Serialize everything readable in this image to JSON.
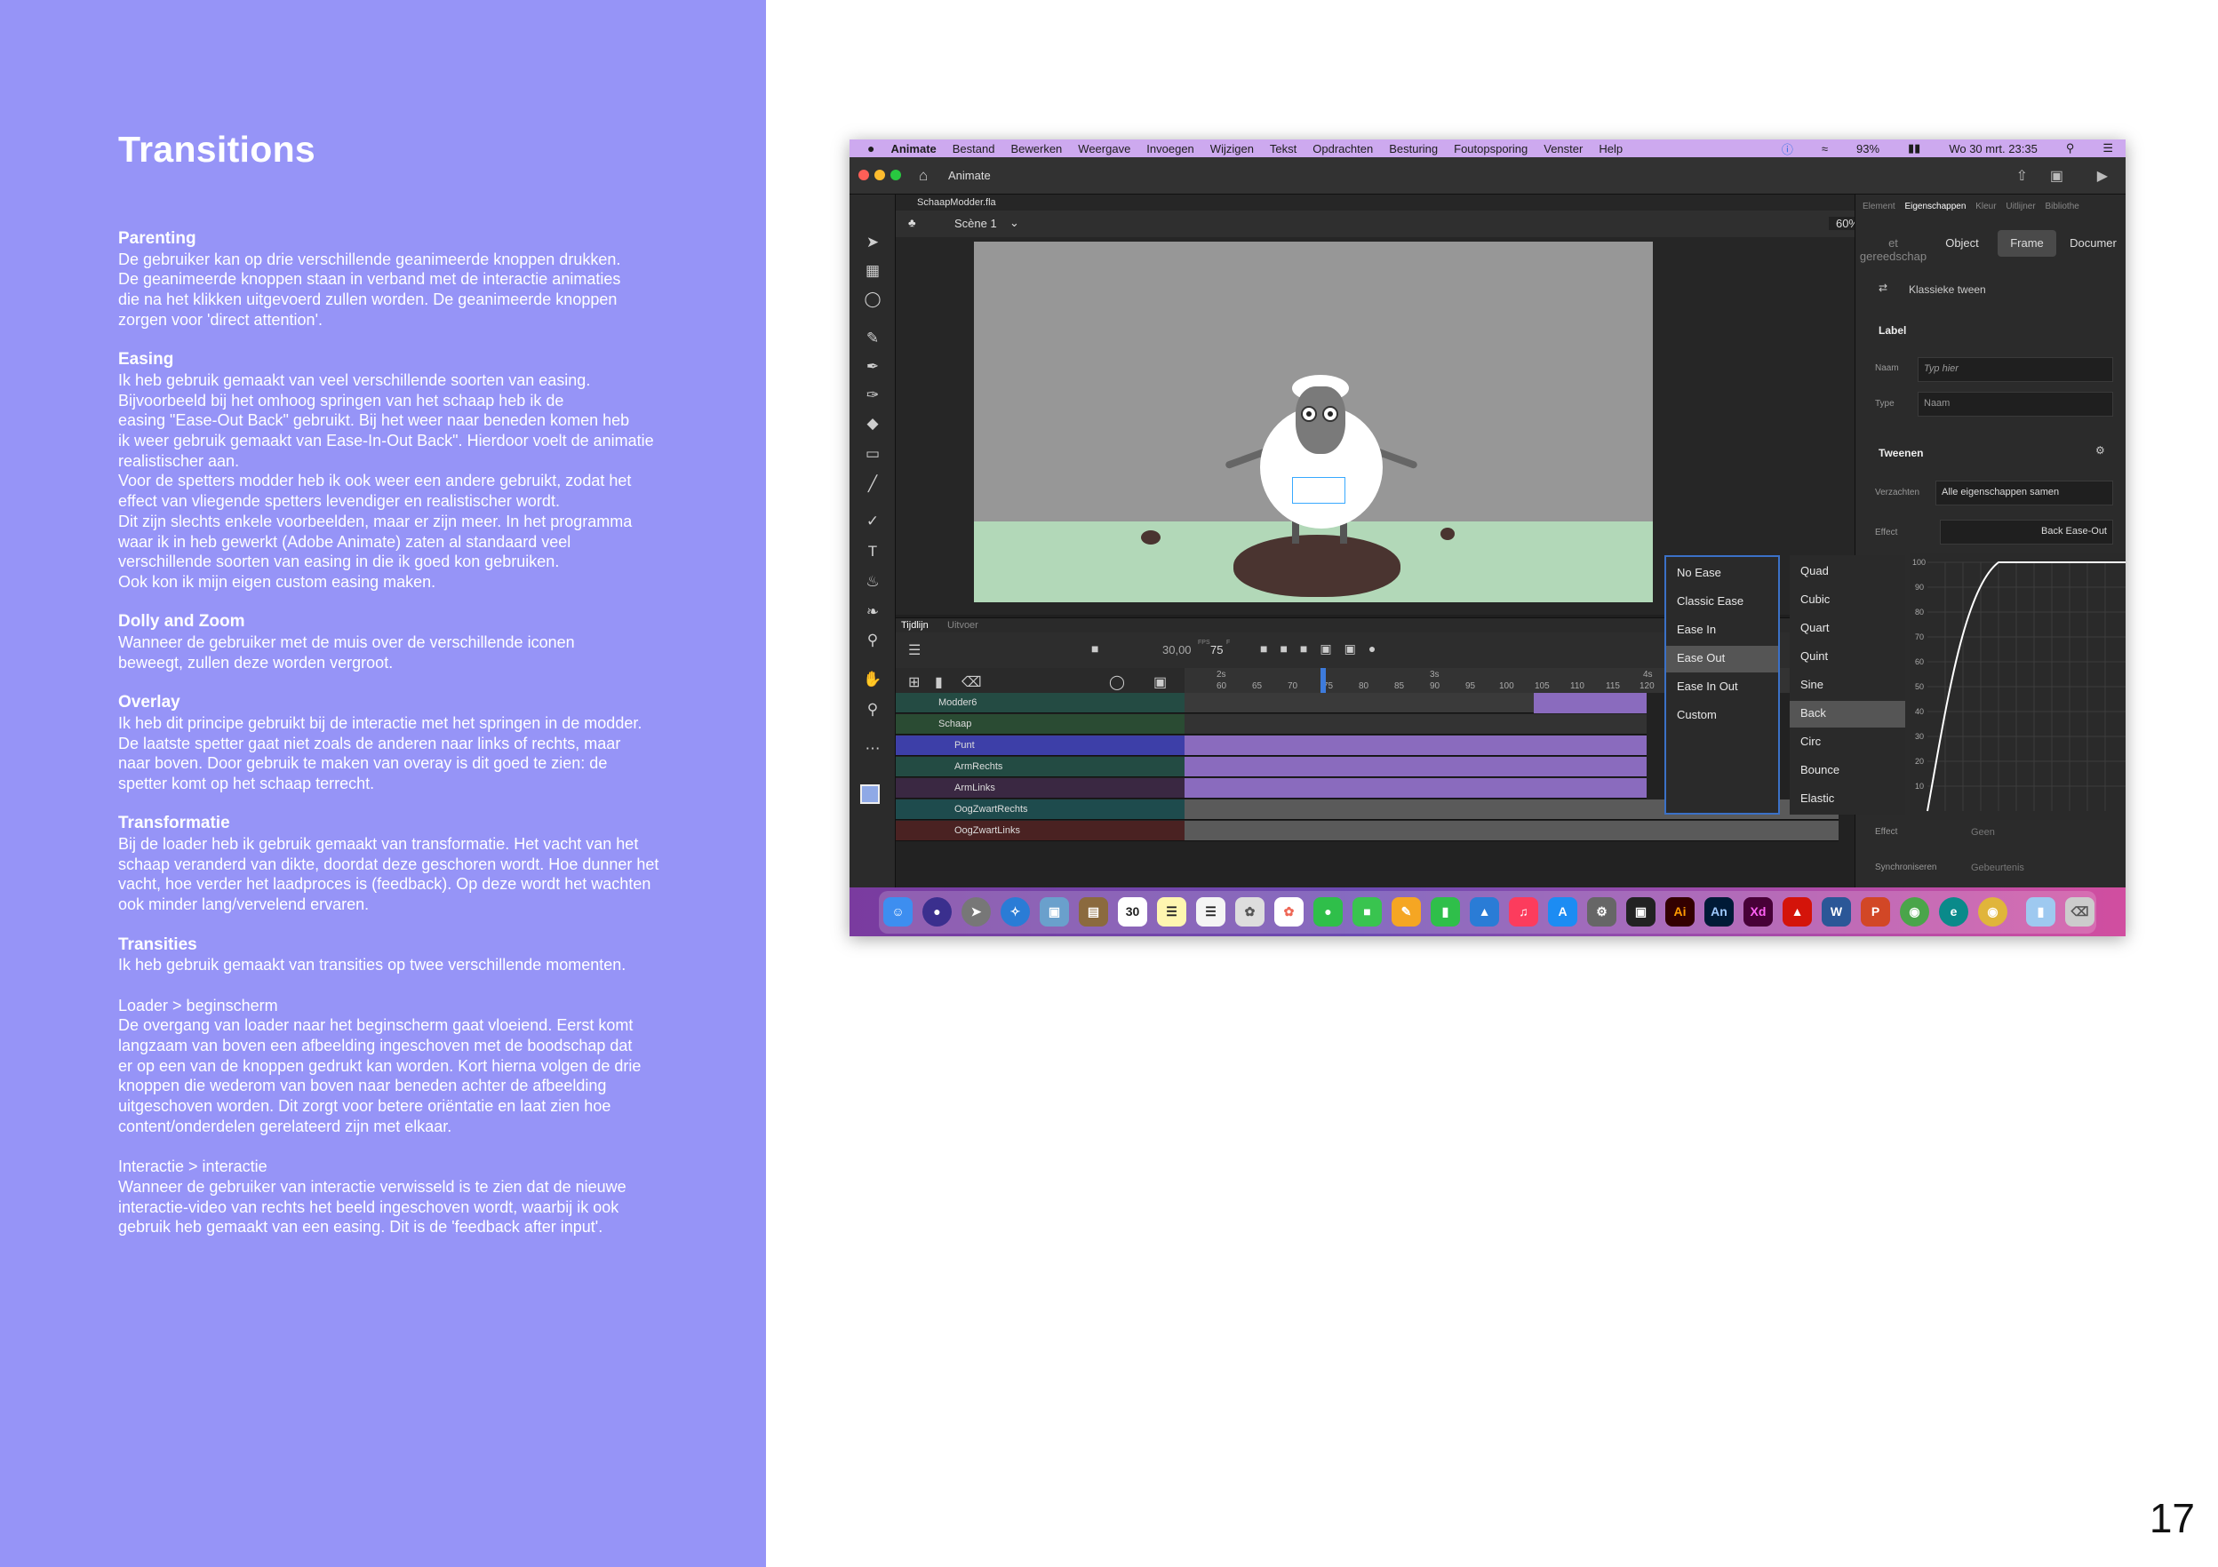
{
  "left": {
    "title": "Transitions",
    "sections": [
      {
        "heading": "Parenting",
        "text": "De gebruiker kan op drie verschillende geanimeerde knoppen drukken.\nDe geanimeerde knoppen staan in verband met de interactie animaties\ndie na het klikken uitgevoerd zullen worden.  De geanimeerde knoppen\nzorgen voor 'direct attention'."
      },
      {
        "heading": "Easing",
        "text": "Ik heb gebruik gemaakt van veel verschillende soorten van easing.\nBijvoorbeeld bij het omhoog springen van het schaap heb ik de\neasing \"Ease-Out Back\" gebruikt. Bij het weer naar beneden komen heb\nik weer gebruik gemaakt van Ease-In-Out Back\". Hierdoor voelt de animatie\nrealistischer aan.\nVoor de spetters modder heb ik ook weer een andere gebruikt, zodat het\neffect van vliegende spetters levendiger en realistischer wordt.\nDit zijn slechts enkele voorbeelden, maar er zijn meer. In het programma\nwaar ik in heb gewerkt (Adobe Animate) zaten al standaard veel\nverschillende soorten van easing in die ik goed kon gebruiken.\nOok kon ik mijn eigen custom easing maken."
      },
      {
        "heading": "Dolly and Zoom",
        "text": "Wanneer de gebruiker met de muis over de verschillende iconen\nbeweegt, zullen deze worden vergroot."
      },
      {
        "heading": "Overlay",
        "text": "Ik heb dit principe gebruikt bij de interactie met het springen in de modder.\nDe laatste spetter gaat niet zoals de anderen naar links of rechts, maar\nnaar boven. Door gebruik te maken van overay is dit goed te zien: de\nspetter komt op het schaap terrecht."
      },
      {
        "heading": "Transformatie",
        "text": "Bij de loader heb ik gebruik gemaakt van transformatie. Het vacht van het\nschaap veranderd van dikte, doordat deze geschoren wordt. Hoe dunner het\nvacht, hoe verder het laadproces is (feedback).  Op deze wordt het wachten\nook minder lang/vervelend ervaren."
      },
      {
        "heading": "Transities",
        "text": "Ik heb gebruik gemaakt van transities op twee verschillende momenten."
      }
    ],
    "para1": "Loader > beginscherm\nDe overgang van loader naar het beginscherm gaat vloeiend. Eerst komt\nlangzaam van boven een afbeelding ingeschoven met de boodschap dat\ner op een van de knoppen gedrukt kan worden. Kort hierna volgen de drie\nknoppen die wederom van boven naar beneden achter de afbeelding\nuitgeschoven worden. Dit zorgt voor betere oriëntatie en laat zien hoe\ncontent/onderdelen gerelateerd zijn met elkaar.",
    "para2": "Interactie > interactie\nWanneer de gebruiker van interactie verwisseld is te zien dat de nieuwe\ninteractie-video van rechts het beeld ingeschoven wordt, waarbij ik ook\ngebruik heb gemaakt van een easing. Dit is de 'feedback after input'."
  },
  "page_number": "17",
  "screenshot": {
    "menubar": {
      "apple": "",
      "items": [
        "Animate",
        "Bestand",
        "Bewerken",
        "Weergave",
        "Invoegen",
        "Wijzigen",
        "Tekst",
        "Opdrachten",
        "Besturing",
        "Foutopsporing",
        "Venster",
        "Help"
      ],
      "battery": "93%",
      "clock": "Wo 30 mrt.  23:35"
    },
    "window_title": "Animate",
    "doc_tab": "SchaapModder.fla",
    "scene": "Scène 1",
    "zoom": "60%",
    "timeline": {
      "tab1": "Tijdlijn",
      "tab2": "Uitvoer",
      "fps": "30,00",
      "fps_unit": "FPS",
      "frame": "75",
      "frame_unit": "F",
      "ruler": [
        "60",
        "65",
        "70",
        "75",
        "80",
        "85",
        "90",
        "95",
        "100",
        "105",
        "110",
        "115",
        "120"
      ],
      "seconds": [
        "2s",
        "3s",
        "4s"
      ],
      "layers": [
        "Modder6",
        "Schaap",
        "Punt",
        "ArmRechts",
        "ArmLinks",
        "OogZwartRechts",
        "OogZwartLinks"
      ]
    },
    "properties": {
      "tabs": [
        "Element",
        "Eigenschappen",
        "Kleur",
        "Uitlijner",
        "Bibliothe"
      ],
      "segments": [
        "et gereedschap",
        "Object",
        "Frame",
        "Documer"
      ],
      "classic_tween": "Klassieke tween",
      "label_section": "Label",
      "name_label": "Naam",
      "name_placeholder": "Typ hier",
      "type_label": "Type",
      "type_value": "Naam",
      "tween_section": "Tweenen",
      "scale_label": "Verzachten",
      "scale_value": "Alle eigenschappen samen",
      "effect_label": "Effect",
      "effect_value": "Back Ease-Out",
      "effect_label2": "Effect",
      "effect_value2": "Geen",
      "sync_label": "Synchroniseren",
      "sync_value": "Gebeurtenis"
    },
    "ease_types": [
      "No Ease",
      "Classic Ease",
      "Ease In",
      "Ease Out",
      "Ease In Out",
      "Custom"
    ],
    "ease_selected": "Ease Out",
    "ease_curves": [
      "Quad",
      "Cubic",
      "Quart",
      "Quint",
      "Sine",
      "Back",
      "Circ",
      "Bounce",
      "Elastic"
    ],
    "curve_selected": "Back",
    "graph_ticks": [
      "100",
      "90",
      "80",
      "70",
      "60",
      "50",
      "40",
      "30",
      "20",
      "10"
    ],
    "dock": [
      "Finder",
      "Siri",
      "Launchpad",
      "Safari",
      "Preview",
      "Notes",
      "30",
      "Notes",
      "Reminders",
      "Photos",
      "Photos",
      "Messages",
      "Facetime",
      "Pages",
      "Numbers",
      "Keynote",
      "Music",
      "App Store",
      "System Preferences",
      "Unity",
      "Ai",
      "An",
      "Xd",
      "Acrobat",
      "Word",
      "PowerPoint",
      "Chrome",
      "Edge",
      "Chrome",
      "Finder",
      "Trash"
    ]
  }
}
